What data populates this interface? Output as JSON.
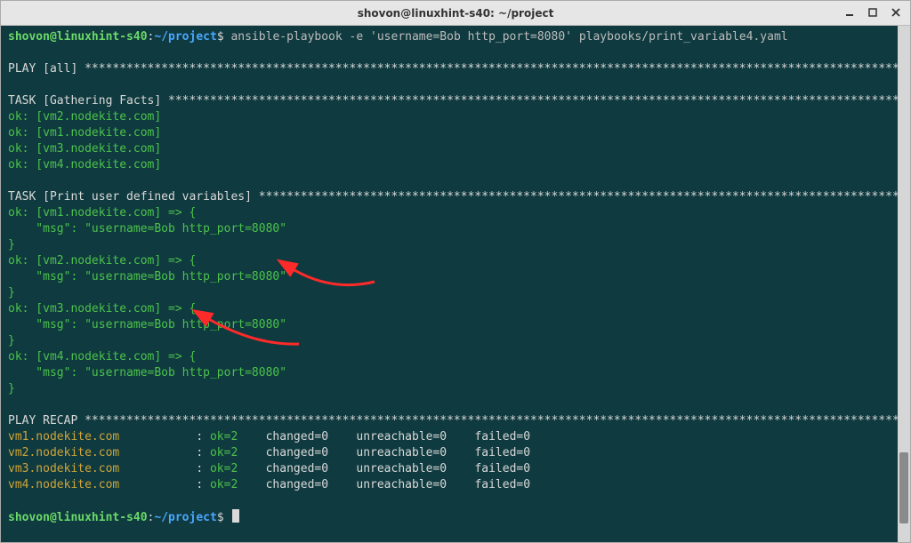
{
  "window": {
    "title": "shovon@linuxhint-s40: ~/project"
  },
  "prompt": {
    "user_host": "shovon@linuxhint-s40",
    "sep1": ":",
    "cwd": "~/project",
    "sep2": "$"
  },
  "command": "ansible-playbook -e 'username=Bob http_port=8080' playbooks/print_variable4.yaml",
  "play_header": "PLAY [all] ",
  "play_stars": "***********************************************************************************************************************",
  "task_gather_header": "TASK [Gathering Facts] ",
  "task_gather_stars": "***********************************************************************************************************",
  "gather_ok": [
    "ok: [vm2.nodekite.com]",
    "ok: [vm1.nodekite.com]",
    "ok: [vm3.nodekite.com]",
    "ok: [vm4.nodekite.com]"
  ],
  "task_print_header": "TASK [Print user defined variables] ",
  "task_print_stars": "**********************************************************************************************",
  "msg_blocks": [
    {
      "open": "ok: [vm1.nodekite.com] => {",
      "msg": "    \"msg\": \"username=Bob http_port=8080\"",
      "close": "}"
    },
    {
      "open": "ok: [vm2.nodekite.com] => {",
      "msg": "    \"msg\": \"username=Bob http_port=8080\"",
      "close": "}"
    },
    {
      "open": "ok: [vm3.nodekite.com] => {",
      "msg": "    \"msg\": \"username=Bob http_port=8080\"",
      "close": "}"
    },
    {
      "open": "ok: [vm4.nodekite.com] => {",
      "msg": "    \"msg\": \"username=Bob http_port=8080\"",
      "close": "}"
    }
  ],
  "recap_header": "PLAY RECAP ",
  "recap_stars": "***********************************************************************************************************************",
  "recap_rows": [
    {
      "host": "vm1.nodekite.com",
      "ok": "ok=2",
      "changed": "changed=0",
      "unreach": "unreachable=0",
      "failed": "failed=0"
    },
    {
      "host": "vm2.nodekite.com",
      "ok": "ok=2",
      "changed": "changed=0",
      "unreach": "unreachable=0",
      "failed": "failed=0"
    },
    {
      "host": "vm3.nodekite.com",
      "ok": "ok=2",
      "changed": "changed=0",
      "unreach": "unreachable=0",
      "failed": "failed=0"
    },
    {
      "host": "vm4.nodekite.com",
      "ok": "ok=2",
      "changed": "changed=0",
      "unreach": "unreachable=0",
      "failed": "failed=0"
    }
  ]
}
